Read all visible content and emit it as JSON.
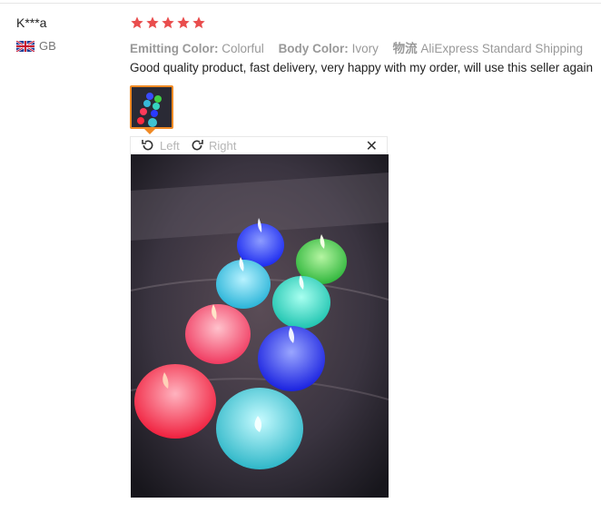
{
  "review": {
    "user_name": "K***a",
    "country_code": "GB",
    "rating": 5,
    "attributes": [
      {
        "key": "Emitting Color:",
        "value": "Colorful"
      },
      {
        "key": "Body Color:",
        "value": "Ivory"
      },
      {
        "key": "物流",
        "value": "AliExpress Standard Shipping"
      }
    ],
    "text": "Good quality product, fast delivery, very happy with my order, will use this seller again",
    "viewer": {
      "rotate_left_label": "Left",
      "rotate_right_label": "Right",
      "close_label": "✕"
    }
  },
  "colors": {
    "star": "#e94d4d",
    "thumb_border": "#f08a24",
    "muted_text": "#999999"
  }
}
